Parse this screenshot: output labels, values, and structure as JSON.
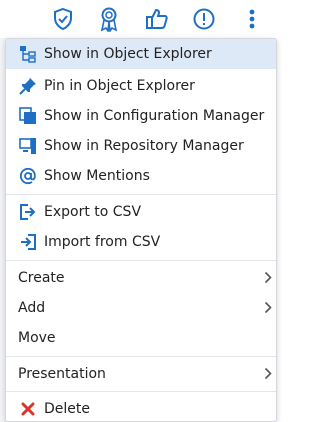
{
  "colors": {
    "accent": "#1f6fc4",
    "danger": "#d9342b",
    "highlight": "#dde9f7"
  },
  "toolbar": {
    "icons": [
      "shield-check-icon",
      "award-ribbon-icon",
      "thumbs-up-icon",
      "alert-circle-icon",
      "more-vertical-icon"
    ]
  },
  "menu": {
    "show_object_explorer": "Show in Object Explorer",
    "pin_object_explorer": "Pin in Object Explorer",
    "show_configuration_manager": "Show in Configuration Manager",
    "show_repository_manager": "Show in Repository Manager",
    "show_mentions": "Show Mentions",
    "export_csv": "Export to CSV",
    "import_csv": "Import from CSV",
    "create": "Create",
    "add": "Add",
    "move": "Move",
    "presentation": "Presentation",
    "delete": "Delete"
  }
}
